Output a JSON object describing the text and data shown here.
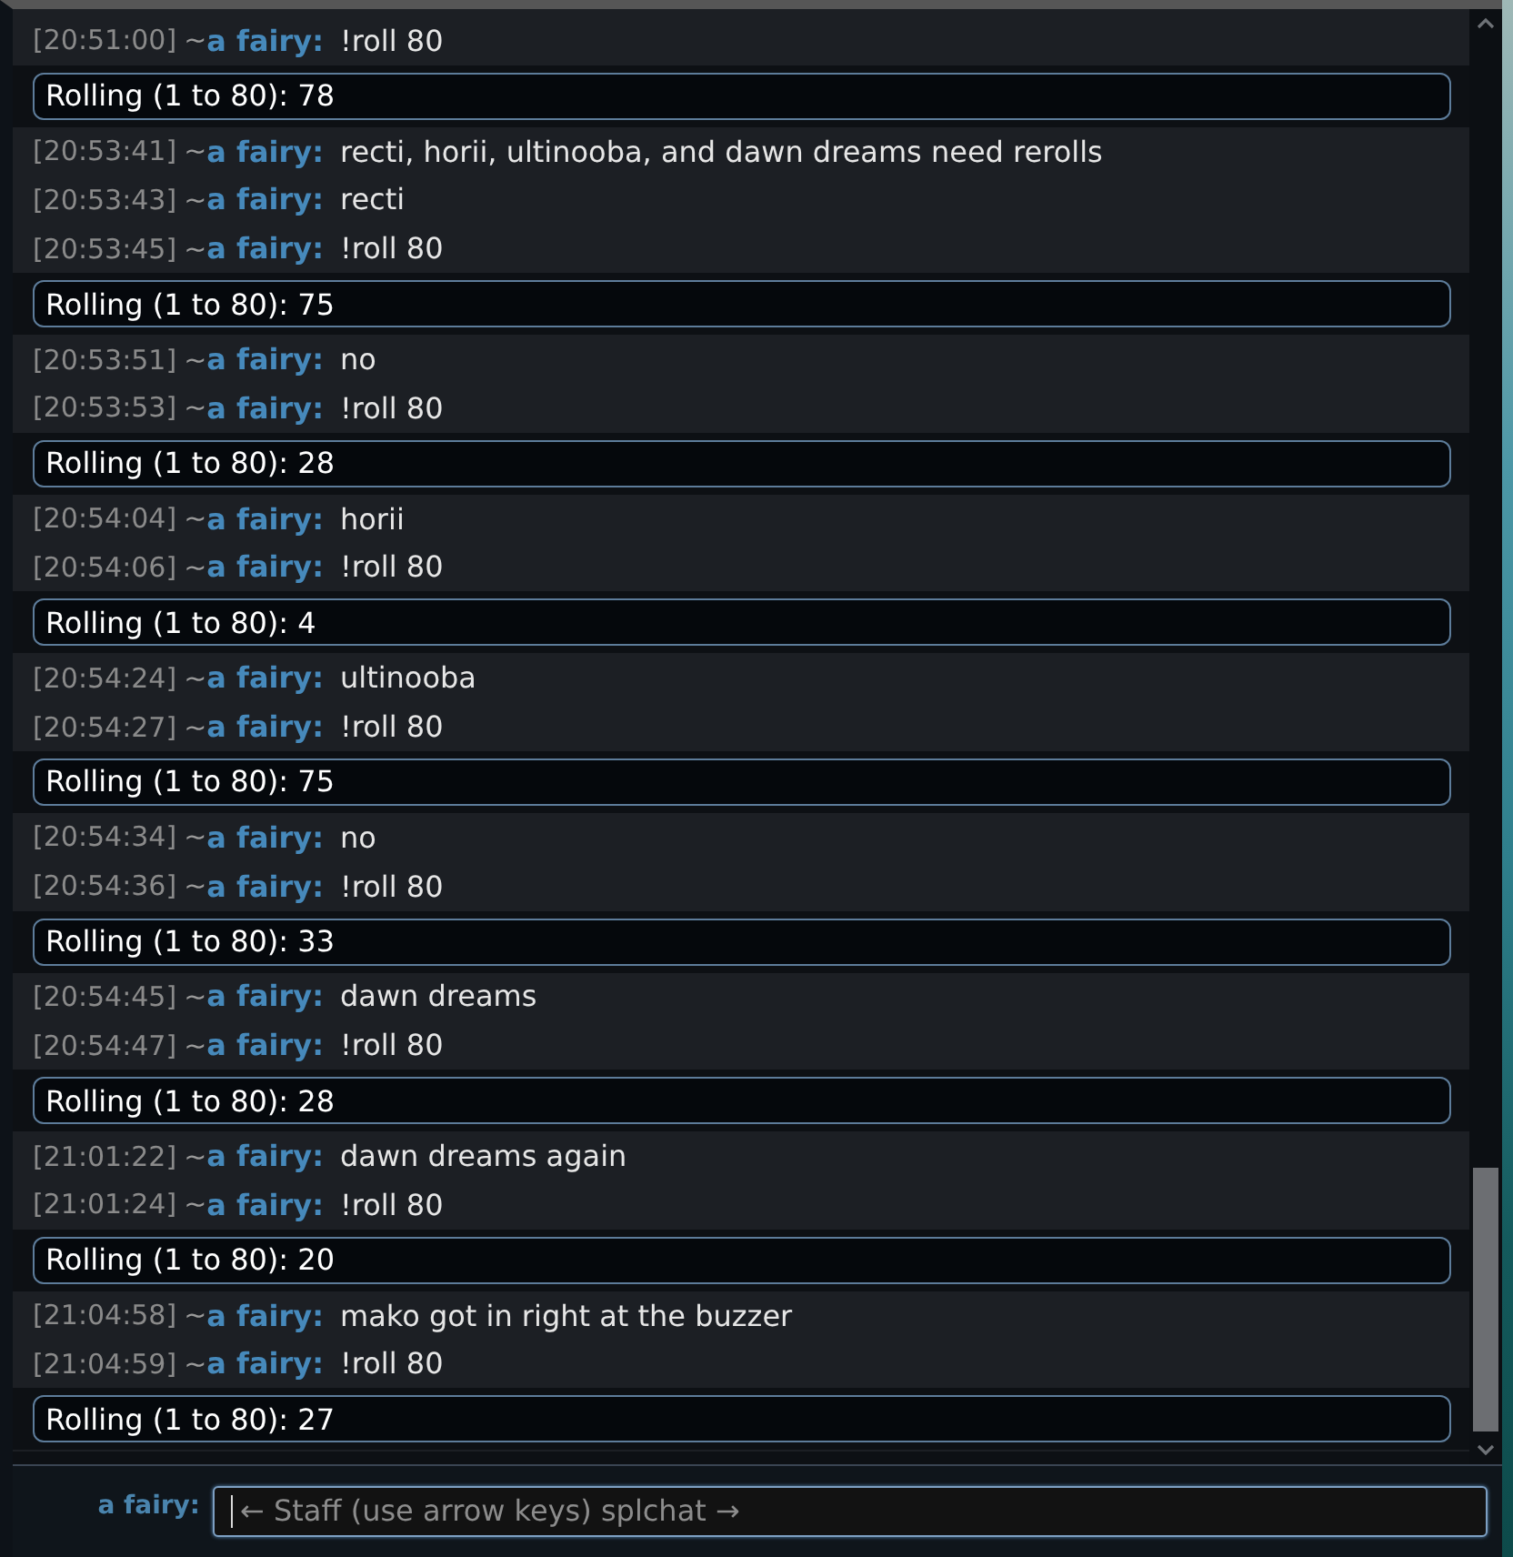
{
  "chat": {
    "messages": [
      {
        "kind": "chat",
        "time": "[20:51:00]",
        "rank": "~",
        "user": "a fairy:",
        "text": "!roll 80"
      },
      {
        "kind": "roll",
        "text": "Rolling (1 to 80): 78"
      },
      {
        "kind": "chat",
        "time": "[20:53:41]",
        "rank": "~",
        "user": "a fairy:",
        "text": "recti, horii, ultinooba, and dawn dreams need rerolls"
      },
      {
        "kind": "chat",
        "time": "[20:53:43]",
        "rank": "~",
        "user": "a fairy:",
        "text": "recti"
      },
      {
        "kind": "chat",
        "time": "[20:53:45]",
        "rank": "~",
        "user": "a fairy:",
        "text": "!roll 80"
      },
      {
        "kind": "roll",
        "text": "Rolling (1 to 80): 75"
      },
      {
        "kind": "chat",
        "time": "[20:53:51]",
        "rank": "~",
        "user": "a fairy:",
        "text": "no"
      },
      {
        "kind": "chat",
        "time": "[20:53:53]",
        "rank": "~",
        "user": "a fairy:",
        "text": "!roll 80"
      },
      {
        "kind": "roll",
        "text": "Rolling (1 to 80): 28"
      },
      {
        "kind": "chat",
        "time": "[20:54:04]",
        "rank": "~",
        "user": "a fairy:",
        "text": "horii"
      },
      {
        "kind": "chat",
        "time": "[20:54:06]",
        "rank": "~",
        "user": "a fairy:",
        "text": "!roll 80"
      },
      {
        "kind": "roll",
        "text": "Rolling (1 to 80): 4"
      },
      {
        "kind": "chat",
        "time": "[20:54:24]",
        "rank": "~",
        "user": "a fairy:",
        "text": "ultinooba"
      },
      {
        "kind": "chat",
        "time": "[20:54:27]",
        "rank": "~",
        "user": "a fairy:",
        "text": "!roll 80"
      },
      {
        "kind": "roll",
        "text": "Rolling (1 to 80): 75"
      },
      {
        "kind": "chat",
        "time": "[20:54:34]",
        "rank": "~",
        "user": "a fairy:",
        "text": "no"
      },
      {
        "kind": "chat",
        "time": "[20:54:36]",
        "rank": "~",
        "user": "a fairy:",
        "text": "!roll 80"
      },
      {
        "kind": "roll",
        "text": "Rolling (1 to 80): 33"
      },
      {
        "kind": "chat",
        "time": "[20:54:45]",
        "rank": "~",
        "user": "a fairy:",
        "text": "dawn dreams"
      },
      {
        "kind": "chat",
        "time": "[20:54:47]",
        "rank": "~",
        "user": "a fairy:",
        "text": "!roll 80"
      },
      {
        "kind": "roll",
        "text": "Rolling (1 to 80): 28"
      },
      {
        "kind": "chat",
        "time": "[21:01:22]",
        "rank": "~",
        "user": "a fairy:",
        "text": "dawn dreams again"
      },
      {
        "kind": "chat",
        "time": "[21:01:24]",
        "rank": "~",
        "user": "a fairy:",
        "text": "!roll 80"
      },
      {
        "kind": "roll",
        "text": "Rolling (1 to 80): 20"
      },
      {
        "kind": "chat",
        "time": "[21:04:58]",
        "rank": "~",
        "user": "a fairy:",
        "text": "mako got in right at the buzzer"
      },
      {
        "kind": "chat",
        "time": "[21:04:59]",
        "rank": "~",
        "user": "a fairy:",
        "text": "!roll 80"
      },
      {
        "kind": "roll",
        "text": "Rolling (1 to 80): 27"
      }
    ]
  },
  "composer": {
    "user": "a fairy:",
    "placeholder": "← Staff (use arrow keys) splchat →",
    "focused": true
  }
}
